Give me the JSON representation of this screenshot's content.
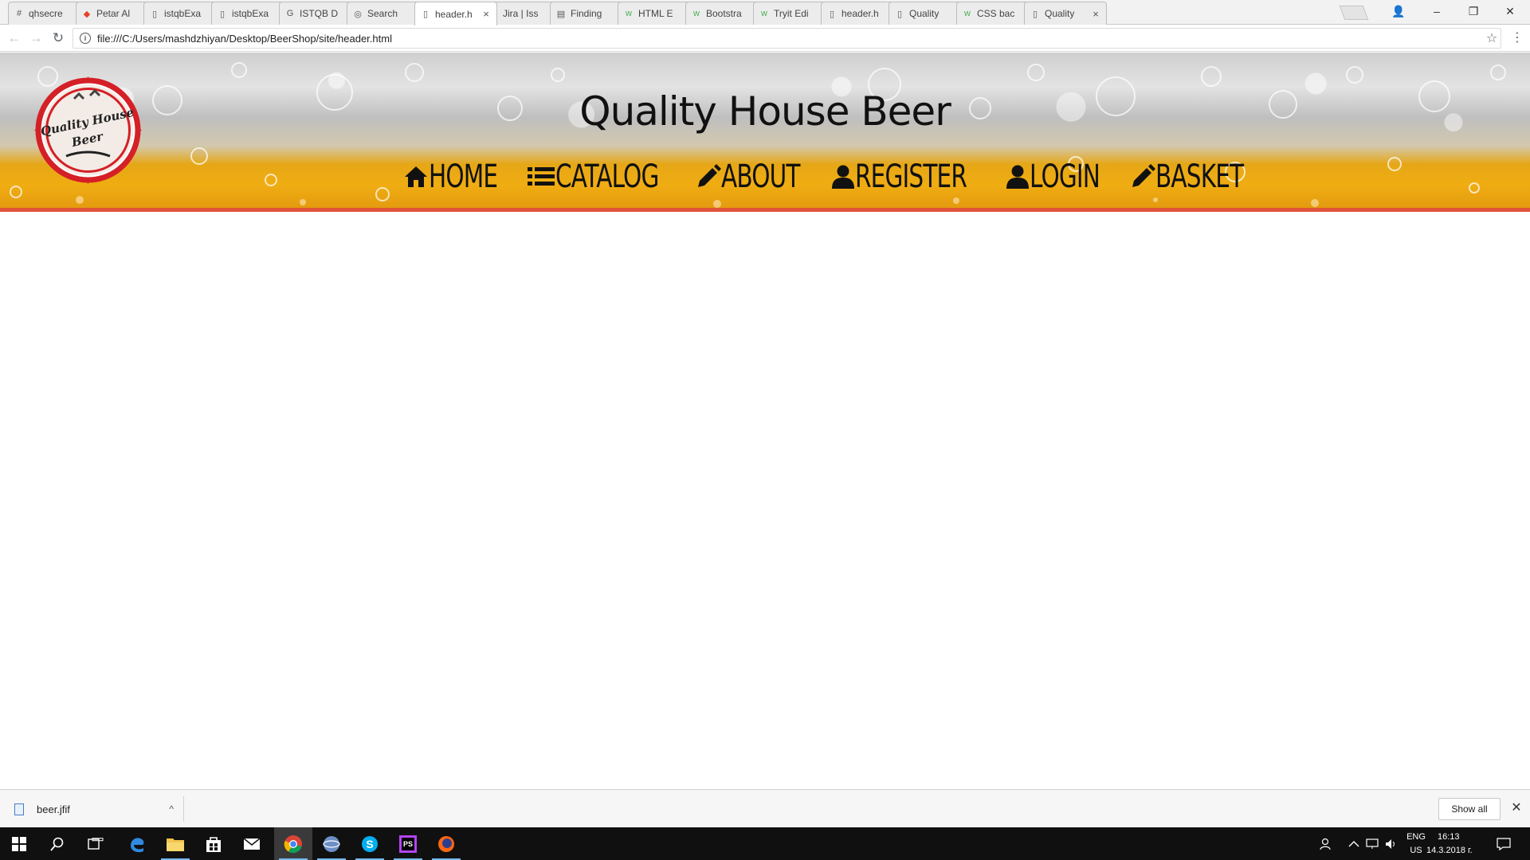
{
  "browser": {
    "tabs": [
      {
        "title": "qhsecre",
        "icon": "hash-icon"
      },
      {
        "title": "Petar Al",
        "icon": "gitlab-icon"
      },
      {
        "title": "istqbExa",
        "icon": "page-icon"
      },
      {
        "title": "istqbExa",
        "icon": "page-icon"
      },
      {
        "title": "ISTQB D",
        "icon": "g-icon"
      },
      {
        "title": "Search",
        "icon": "circle-icon"
      },
      {
        "title": "header.h",
        "icon": "page-icon",
        "active": true
      },
      {
        "title": "Jira | Iss",
        "icon": "jira-icon"
      },
      {
        "title": "Finding",
        "icon": "book-icon"
      },
      {
        "title": "HTML E",
        "icon": "w3-icon"
      },
      {
        "title": "Bootstra",
        "icon": "w3-icon"
      },
      {
        "title": "Tryit Edi",
        "icon": "w3-icon"
      },
      {
        "title": "header.h",
        "icon": "page-icon"
      },
      {
        "title": "Quality",
        "icon": "page-icon"
      },
      {
        "title": "CSS bac",
        "icon": "w3-icon"
      },
      {
        "title": "Quality",
        "icon": "page-icon"
      }
    ],
    "close_glyph": "×",
    "url": "file:///C:/Users/mashdzhiyan/Desktop/BeerShop/site/header.html",
    "info_glyph": "i",
    "back_glyph": "←",
    "forward_glyph": "→",
    "reload_glyph": "↻",
    "star_glyph": "☆",
    "menu_glyph": "⋮",
    "window": {
      "account": "👤",
      "minimize": "–",
      "restore": "❐",
      "close": "✕"
    }
  },
  "site": {
    "title": "Quality House Beer",
    "logo_text_line1": "Quality House",
    "logo_text_line2": "Beer",
    "nav": [
      {
        "label": "HOME",
        "icon": "home-icon"
      },
      {
        "label": "CATALOG",
        "icon": "list-icon"
      },
      {
        "label": "ABOUT",
        "icon": "pencil-icon"
      },
      {
        "label": "REGISTER",
        "icon": "user-icon"
      },
      {
        "label": "LOGIN",
        "icon": "user-icon"
      },
      {
        "label": "BASKET",
        "icon": "pencil-icon"
      }
    ],
    "colors": {
      "header_border": "#e0523a",
      "beer": "#f0ad12"
    }
  },
  "downloads": {
    "file_name": "beer.jfif",
    "caret": "^",
    "show_all": "Show all",
    "close": "✕"
  },
  "taskbar": {
    "lang_line1": "ENG",
    "lang_line2": "US",
    "time": "16:13",
    "date": "14.3.2018 г."
  }
}
